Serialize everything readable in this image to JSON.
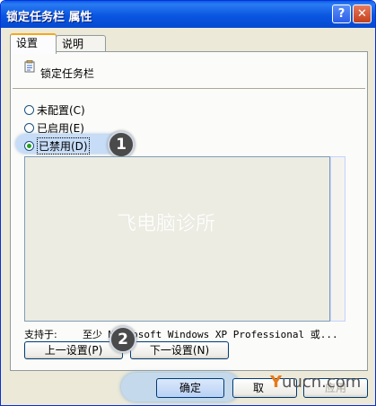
{
  "window": {
    "title": "锁定任务栏 属性",
    "help_label": "?",
    "close_label": "✕"
  },
  "tabs": [
    {
      "label": "设置",
      "active": true
    },
    {
      "label": "说明",
      "active": false
    }
  ],
  "policy": {
    "icon": "policy-setting-icon",
    "name": "锁定任务栏"
  },
  "options": [
    {
      "label": "未配置(C)",
      "checked": false
    },
    {
      "label": "已启用(E)",
      "checked": false
    },
    {
      "label": "已禁用(D)",
      "checked": true
    }
  ],
  "watermark": "飞电脑诊所",
  "support": {
    "label": "支持于:",
    "value": "至少 Microsoft Windows XP Professional 或..."
  },
  "buttons": {
    "prev": "上一设置(P)",
    "next": "下一设置(N)",
    "ok": "确定",
    "cancel": "取",
    "apply": "应用"
  },
  "badges": {
    "step1": "1",
    "step2": "2"
  },
  "site_watermark": {
    "y": "Y",
    "rest": "uucn.com"
  },
  "colors": {
    "titlebar": "#0a5ce8",
    "dialog_bg": "#ece9d8",
    "close": "#c4401c",
    "radio_checked": "#21a121"
  }
}
